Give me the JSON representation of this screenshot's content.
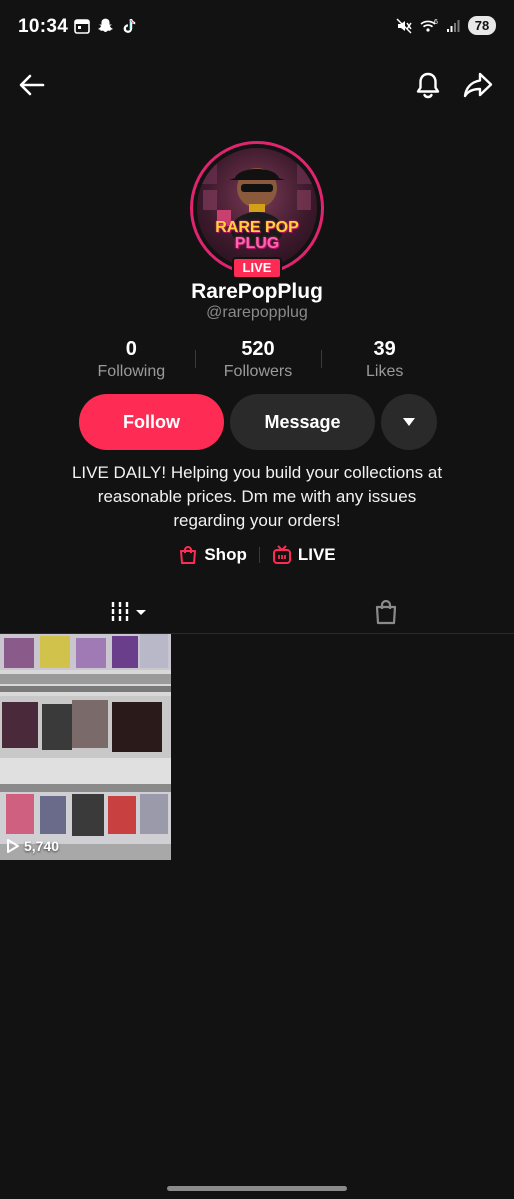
{
  "status_bar": {
    "time": "10:34",
    "battery": "78"
  },
  "profile": {
    "display_name": "RarePopPlug",
    "handle": "@rarepopplug",
    "avatar_text_line1": "RARE POP",
    "avatar_text_line2": "PLUG",
    "live_badge": "LIVE"
  },
  "stats": [
    {
      "value": "0",
      "label": "Following"
    },
    {
      "value": "520",
      "label": "Followers"
    },
    {
      "value": "39",
      "label": "Likes"
    }
  ],
  "actions": {
    "follow": "Follow",
    "message": "Message"
  },
  "bio": "LIVE DAILY! Helping you build your collections at reasonable prices. Dm me with any issues regarding your orders!",
  "links": {
    "shop": "Shop",
    "live": "LIVE"
  },
  "videos": [
    {
      "views": "5,740"
    }
  ],
  "colors": {
    "accent": "#fe2c55",
    "background": "#121212",
    "button_secondary": "#2a2a2a"
  }
}
